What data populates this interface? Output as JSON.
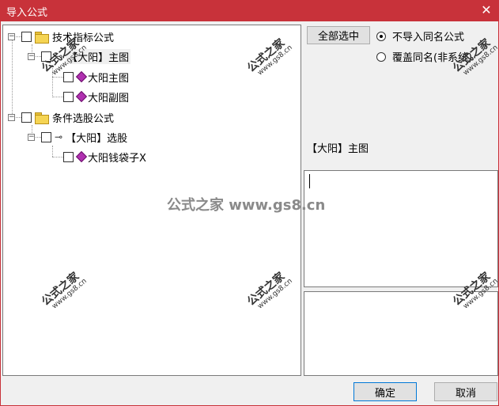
{
  "window": {
    "title": "导入公式",
    "close_glyph": "✕"
  },
  "tree": {
    "nodes": [
      {
        "label": "技术指标公式"
      },
      {
        "label": "【大阳】主图"
      },
      {
        "label": "大阳主图"
      },
      {
        "label": "大阳副图"
      },
      {
        "label": "条件选股公式"
      },
      {
        "label": "【大阳】选股"
      },
      {
        "label": "大阳钱袋子X"
      }
    ]
  },
  "actions": {
    "select_all": "全部选中"
  },
  "options": {
    "no_import_same": "不导入同名公式",
    "overwrite_same": "覆盖同名(非系统)"
  },
  "preview": {
    "selected_name": "【大阳】主图"
  },
  "footer": {
    "ok": "确定",
    "cancel": "取消"
  },
  "watermark": {
    "brand": "公式之家",
    "site": "www.gs8.cn",
    "center": "公式之家 www.gs8.cn"
  },
  "colors": {
    "titlebar": "#c8323a",
    "folder": "#f5d453",
    "gem": "#b030b0"
  },
  "icons": [
    "folder-icon",
    "key-icon",
    "gem-icon",
    "close-icon"
  ]
}
